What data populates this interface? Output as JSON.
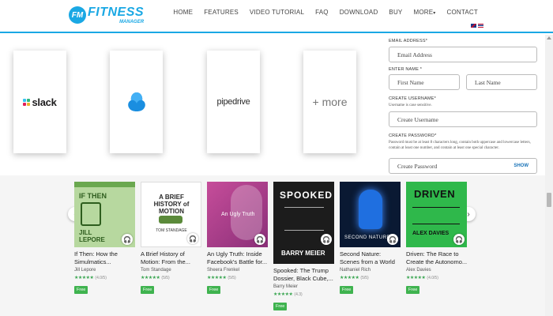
{
  "brand": {
    "badge": "FM",
    "name": "FITNESS",
    "sub": "MANAGER"
  },
  "nav": [
    "HOME",
    "FEATURES",
    "VIDEO TUTORIAL",
    "FAQ",
    "DOWNLOAD",
    "BUY",
    "MORE",
    "CONTACT"
  ],
  "integrations": {
    "slack": "slack",
    "pipedrive": "pipedrive",
    "more": "+ more"
  },
  "form": {
    "email_label": "EMAIL ADDRESS*",
    "email_placeholder": "Email Address",
    "name_label": "ENTER NAME *",
    "first_placeholder": "First Name",
    "last_placeholder": "Last Name",
    "username_label": "CREATE USERNAME*",
    "username_note": "Username is case sensitive.",
    "username_placeholder": "Create Username",
    "password_label": "CREATE PASSWORD*",
    "password_note": "Password must be at least 8 characters long, contain both uppercase and lowercase letters, contain at least one number, and contain at least one special character.",
    "password_placeholder": "Create Password",
    "show_label": "SHOW"
  },
  "books": [
    {
      "title": "If Then: How the Simulmatics...",
      "author": "Jill Lepore",
      "rating": "(4.0/5)",
      "stars": "★★★★★",
      "badge": "Free",
      "cover_top": "IF THEN",
      "cover_bottom": "JILL LEPORE"
    },
    {
      "title": "A Brief History of Motion: From the...",
      "author": "Tom Standage",
      "rating": "(5/5)",
      "stars": "★★★★★",
      "badge": "Free",
      "cover_top": "A BRIEF HISTORY of MOTION",
      "cover_bottom": "TOM STANDAGE"
    },
    {
      "title": "An Ugly Truth: Inside Facebook's Battle for...",
      "author": "Sheera Frenkel",
      "rating": "(5/5)",
      "stars": "★★★★★",
      "badge": "Free",
      "cover_top": "An Ugly Truth",
      "cover_bottom": ""
    },
    {
      "title": "Spooked: The Trump Dossier, Black Cube,...",
      "author": "Barry Meier",
      "rating": "(4.3)",
      "stars": "★★★★★",
      "badge": "Free",
      "cover_top": "SPOOKED",
      "cover_bottom": "BARRY MEIER"
    },
    {
      "title": "Second Nature: Scenes from a World Remade",
      "author": "Nathaniel Rich",
      "rating": "(5/5)",
      "stars": "★★★★★",
      "badge": "Free",
      "cover_top": "SECOND NATURE",
      "cover_bottom": "NATHANIEL RICH"
    },
    {
      "title": "Driven: The Race to Create the Autonomo...",
      "author": "Alex Davies",
      "rating": "(4.0/5)",
      "stars": "★★★★★",
      "badge": "Free",
      "cover_top": "DRIVEN",
      "cover_bottom": "ALEX DAVIES"
    }
  ],
  "colors": {
    "brand": "#1aa8e4",
    "star": "#3aa651",
    "free": "#3fb34f"
  }
}
